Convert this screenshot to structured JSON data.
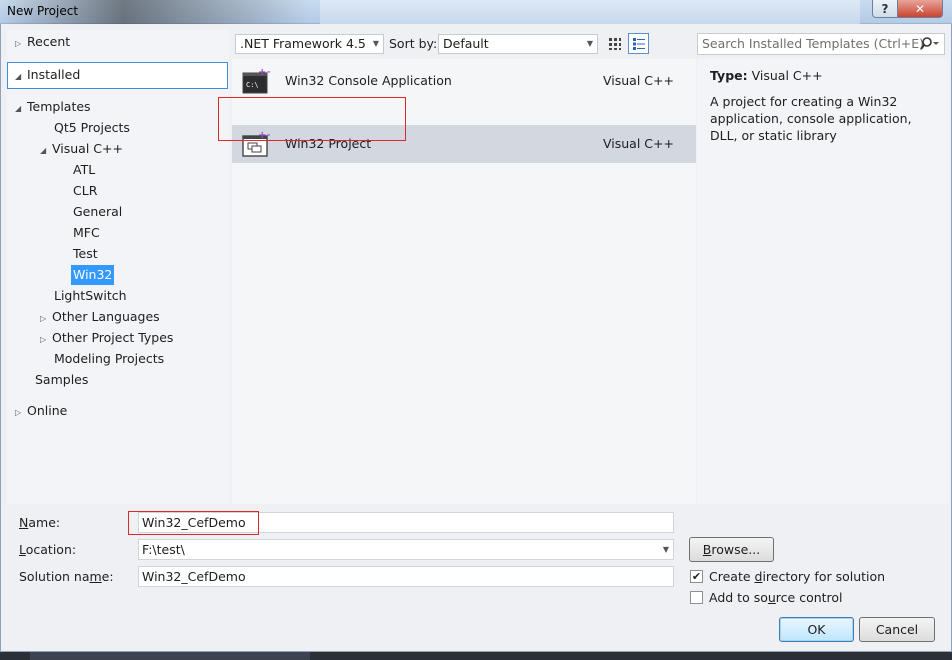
{
  "window": {
    "title": "New Project",
    "help_label": "?",
    "close_label": "✕"
  },
  "tree": {
    "recent": "Recent",
    "installed": "Installed",
    "templates": "Templates",
    "qt5": "Qt5 Projects",
    "visual_cpp": "Visual C++",
    "atl": "ATL",
    "clr": "CLR",
    "general": "General",
    "mfc": "MFC",
    "test": "Test",
    "win32": "Win32",
    "lightswitch": "LightSwitch",
    "other_languages": "Other Languages",
    "other_project_types": "Other Project Types",
    "modeling_projects": "Modeling Projects",
    "samples": "Samples",
    "online": "Online"
  },
  "toolbar": {
    "framework": ".NET Framework 4.5",
    "sort_label": "Sort by:",
    "sort_value": "Default",
    "search_placeholder": "Search Installed Templates (Ctrl+E)"
  },
  "templates": [
    {
      "name": "Win32 Console Application",
      "language": "Visual C++"
    },
    {
      "name": "Win32 Project",
      "language": "Visual C++"
    }
  ],
  "info": {
    "type_label": "Type:",
    "type_value": "Visual C++",
    "description": "A project for creating a Win32 application, console application, DLL, or static library"
  },
  "form": {
    "name_label": "Name:",
    "name_value": "Win32_CefDemo",
    "location_label": "Location:",
    "location_value": "F:\\test\\",
    "solution_label": "Solution name:",
    "solution_value": "Win32_CefDemo",
    "browse_label": "Browse...",
    "create_dir_label": "Create directory for solution",
    "create_dir_checked": true,
    "source_control_label": "Add to source control",
    "source_control_checked": false,
    "ok_label": "OK",
    "cancel_label": "Cancel"
  },
  "colors": {
    "selection": "#3399ff",
    "highlight_box": "#e0282a",
    "selected_row": "#d3d7e0"
  }
}
